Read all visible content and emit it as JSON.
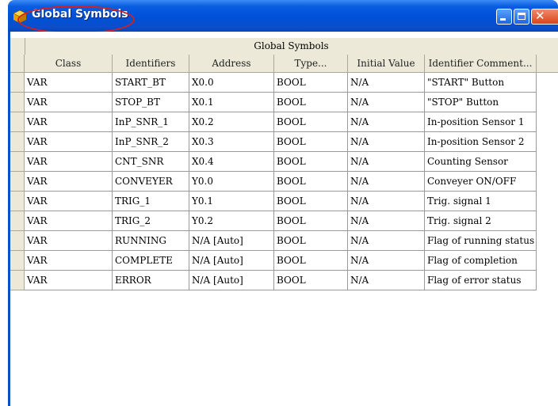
{
  "window": {
    "title": "Global Symbols",
    "buttons": {
      "minimize": "minimize",
      "maximize": "maximize",
      "close": "close"
    }
  },
  "table": {
    "group_title": "Global Symbols",
    "columns": [
      "Class",
      "Identifiers",
      "Address",
      "Type...",
      "Initial Value",
      "Identifier Comment..."
    ],
    "rows": [
      [
        "VAR",
        "START_BT",
        "X0.0",
        "BOOL",
        "N/A",
        "\"START\" Button"
      ],
      [
        "VAR",
        "STOP_BT",
        "X0.1",
        "BOOL",
        "N/A",
        "\"STOP\" Button"
      ],
      [
        "VAR",
        "InP_SNR_1",
        "X0.2",
        "BOOL",
        "N/A",
        "In-position Sensor 1"
      ],
      [
        "VAR",
        "InP_SNR_2",
        "X0.3",
        "BOOL",
        "N/A",
        "In-position Sensor 2"
      ],
      [
        "VAR",
        "CNT_SNR",
        "X0.4",
        "BOOL",
        "N/A",
        "Counting Sensor"
      ],
      [
        "VAR",
        "CONVEYER",
        "Y0.0",
        "BOOL",
        "N/A",
        "Conveyer ON/OFF"
      ],
      [
        "VAR",
        "TRIG_1",
        "Y0.1",
        "BOOL",
        "N/A",
        "Trig. signal 1"
      ],
      [
        "VAR",
        "TRIG_2",
        "Y0.2",
        "BOOL",
        "N/A",
        "Trig. signal 2"
      ],
      [
        "VAR",
        "RUNNING",
        "N/A [Auto]",
        "BOOL",
        "N/A",
        "Flag of running status"
      ],
      [
        "VAR",
        "COMPLETE",
        "N/A [Auto]",
        "BOOL",
        "N/A",
        "Flag of completion"
      ],
      [
        "VAR",
        "ERROR",
        "N/A [Auto]",
        "BOOL",
        "N/A",
        "Flag of error status"
      ]
    ]
  },
  "colors": {
    "titlebar": "#0050d8",
    "highlight": "#d42020",
    "header_bg": "#ece9d8"
  },
  "icons": {
    "app": "cube-icon"
  }
}
